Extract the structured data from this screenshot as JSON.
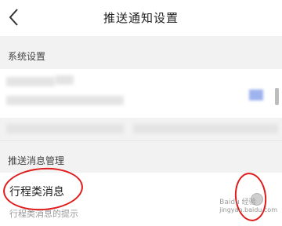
{
  "header": {
    "title": "推送通知设置",
    "back_icon": "chevron-left-icon"
  },
  "sections": {
    "system": {
      "label": "系统设置"
    },
    "push": {
      "label": "推送消息管理"
    }
  },
  "push_items": [
    {
      "title": "行程类消息",
      "subtitle": "行程类消息的提示",
      "toggle": "off"
    }
  ],
  "annotations": {
    "color": "#e01b1b"
  },
  "watermark": {
    "brand": "Baidu 经验",
    "url": "jingyan.baidu.com"
  }
}
